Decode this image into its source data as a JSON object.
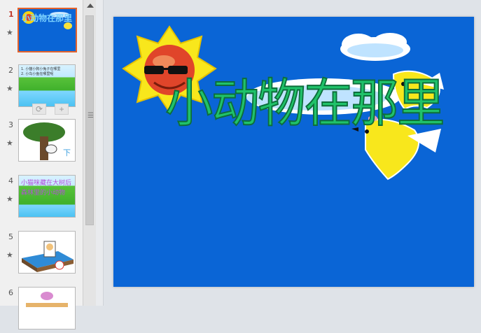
{
  "thumbnails": [
    {
      "number": "1",
      "title_text": "小动物在那里",
      "active": true
    },
    {
      "number": "2",
      "text_line1": "1. 小猫小狗小兔子在哪里",
      "text_line2": "2. 小鸟小鱼在哪里呢"
    },
    {
      "number": "3",
      "label": "下"
    },
    {
      "number": "4",
      "text_line1": "小猫咪藏在大树后",
      "text_line2": "森林里的小动物"
    },
    {
      "number": "5"
    },
    {
      "number": "6"
    }
  ],
  "slide": {
    "title": "小动物在那里"
  },
  "colors": {
    "slide_background": "#0a65d6",
    "title_fill": "#20c26a",
    "active_thumb_border": "#e4622b"
  },
  "icons": [
    "star-icon",
    "sun-icon",
    "cloud-icon",
    "bird-icon",
    "scroll-up-icon",
    "copy-icon",
    "add-icon"
  ]
}
